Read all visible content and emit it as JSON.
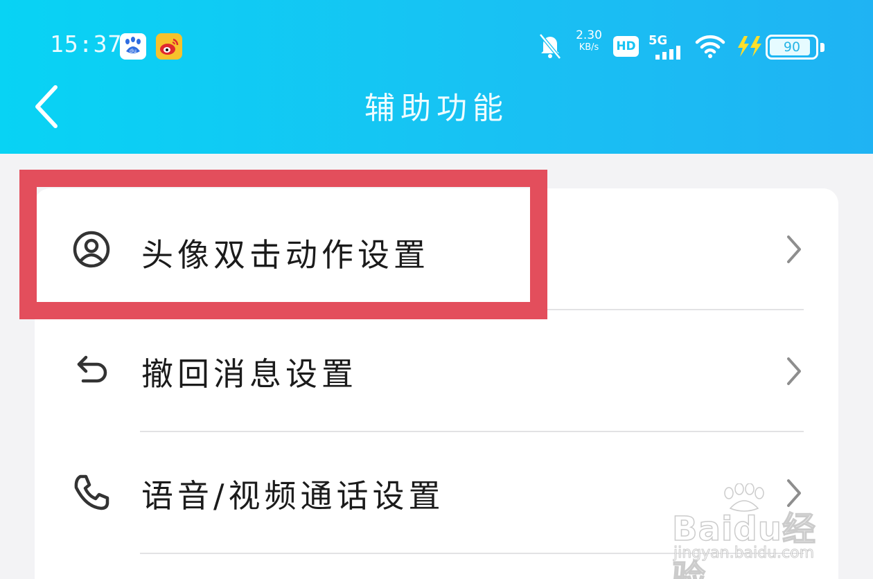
{
  "status_bar": {
    "time": "15:37",
    "net_speed_value": "2.30",
    "net_speed_unit": "KB/s",
    "hd_badge": "HD",
    "network": "5G",
    "battery_level": "90",
    "battery_fraction": 0.9,
    "notification_icons": [
      "baidu-app-icon",
      "weibo-app-icon"
    ],
    "indicator_icons": [
      "bell-muted-icon",
      "signal-bars-icon",
      "wifi-icon",
      "charging-bolt-icon",
      "battery-icon"
    ]
  },
  "nav": {
    "title": "辅助功能",
    "back_icon": "chevron-left-icon"
  },
  "menu": {
    "items": [
      {
        "label": "头像双击动作设置",
        "icon": "avatar-circle-icon"
      },
      {
        "label": "撤回消息设置",
        "icon": "undo-arrow-icon"
      },
      {
        "label": "语音/视频通话设置",
        "icon": "phone-icon"
      }
    ],
    "chevron_icon": "chevron-right-icon"
  },
  "annotation": {
    "highlight_color": "#e34e5c"
  },
  "watermark": {
    "brand": "Baidu经验",
    "domain": "jingyan.baidu.com"
  },
  "colors": {
    "header_start": "#08d3f4",
    "header_end": "#1fb3f3",
    "background": "#f3f3f5",
    "card": "#ffffff",
    "text": "#1b1b1b"
  }
}
